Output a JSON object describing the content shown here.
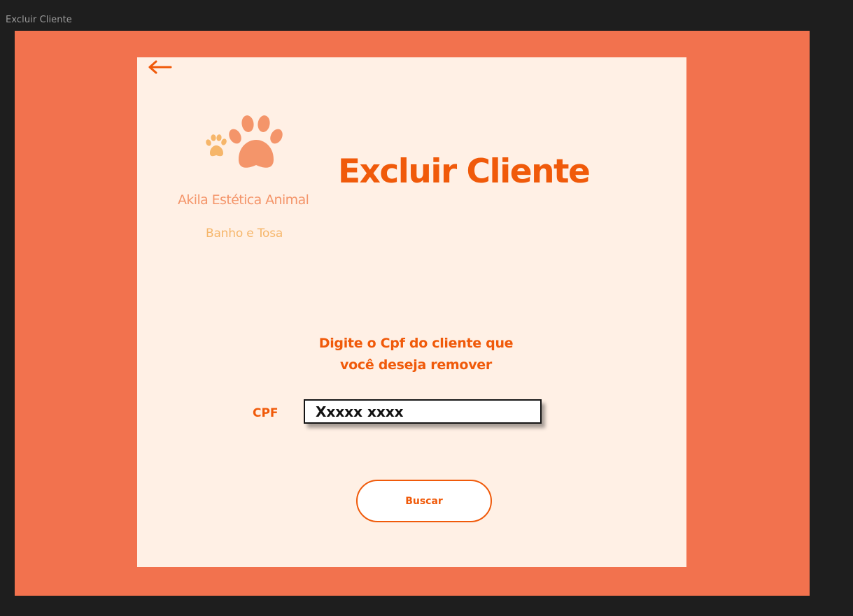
{
  "window": {
    "frame_title": "Excluir Cliente"
  },
  "colors": {
    "frame_background": "#f2724e",
    "card_background": "#fff0e5",
    "accent": "#f05a0a",
    "brand_name": "#f4956a",
    "brand_sub": "#f6b66a"
  },
  "brand": {
    "logo_icon": "paw-print-icon",
    "name": "Akila Estética  Animal",
    "subtitle": "Banho e Tosa"
  },
  "header": {
    "back_icon": "arrow-left-icon",
    "title": "Excluir Cliente"
  },
  "form": {
    "instruction_line1": "Digite o Cpf do cliente que",
    "instruction_line2": "você deseja remover",
    "cpf_label": "CPF",
    "cpf_value": "",
    "cpf_placeholder": "Xxxxx xxxx",
    "search_label": "Buscar"
  }
}
